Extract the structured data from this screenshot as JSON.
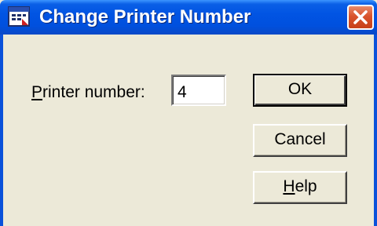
{
  "window": {
    "title": "Change Printer Number",
    "icon": "app-window-icon",
    "close_icon": "close-icon"
  },
  "form": {
    "label_prefix": "",
    "label_accel": "P",
    "label_rest": "rinter number:",
    "value": "4"
  },
  "buttons": {
    "ok": "OK",
    "cancel": "Cancel",
    "help_accel": "H",
    "help_rest": "elp"
  },
  "colors": {
    "titlebar": "#0154e3",
    "close": "#d9532c",
    "face": "#ece9d8"
  }
}
